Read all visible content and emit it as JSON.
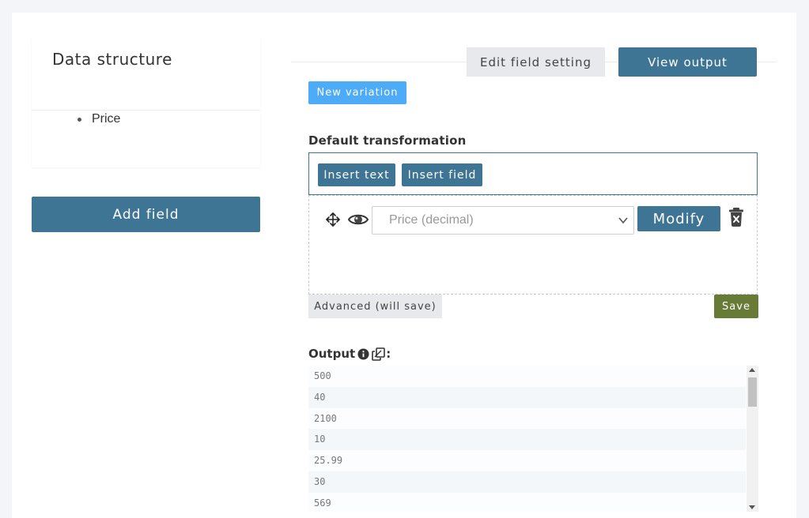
{
  "data_structure": {
    "title": "Data structure",
    "items": [
      {
        "label": "Price"
      }
    ],
    "add_field_label": "Add field"
  },
  "tabs": {
    "edit_label": "Edit field setting",
    "view_label": "View output"
  },
  "new_variation_label": "New variation",
  "default_transformation": {
    "label": "Default transformation",
    "insert_text_label": "Insert text",
    "insert_field_label": "Insert field",
    "selected_field": "Price (decimal)",
    "modify_label": "Modify"
  },
  "advanced_label": "Advanced (will save)",
  "save_label": "Save",
  "output": {
    "label": "Output",
    "suffix": ":",
    "rows": [
      "500",
      "40",
      "2100",
      "10",
      "25.99",
      "30",
      "569"
    ]
  },
  "colors": {
    "primary": "#3e7595",
    "light_blue": "#4dabf7",
    "save_green": "#677b37",
    "neutral_button": "#e7e9ec"
  }
}
